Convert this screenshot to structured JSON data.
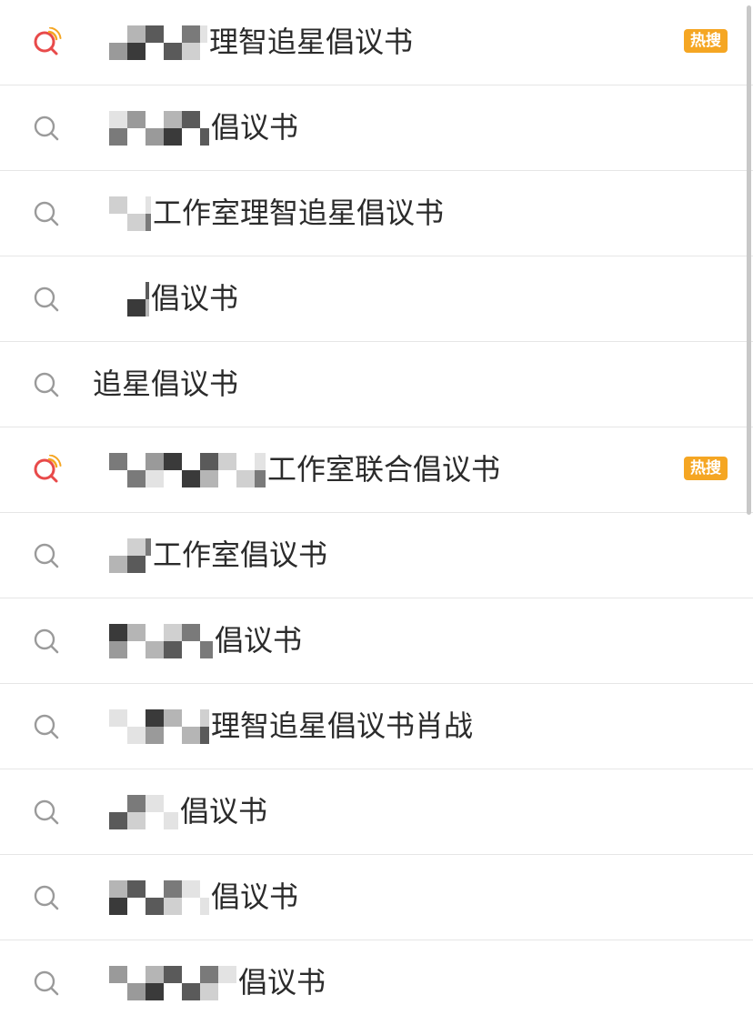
{
  "hot_badge_label": "热搜",
  "colors": {
    "hot_icon_red": "#e84a4a",
    "hot_icon_orange": "#f5a623",
    "badge_bg": "#f5a623",
    "normal_icon": "#9a9a9a",
    "text": "#2b2b2b",
    "divider": "#e6e6e6"
  },
  "results": [
    {
      "text": "理智追星倡议书",
      "hot": true,
      "redacted": true
    },
    {
      "text": "倡议书",
      "hot": false,
      "redacted": true
    },
    {
      "text": "工作室理智追星倡议书",
      "hot": false,
      "redacted": true
    },
    {
      "text": "倡议书",
      "hot": false,
      "redacted": true
    },
    {
      "text": "追星倡议书",
      "hot": false,
      "redacted": false
    },
    {
      "text": "工作室联合倡议书",
      "hot": true,
      "redacted": true
    },
    {
      "text": "工作室倡议书",
      "hot": false,
      "redacted": true
    },
    {
      "text": "倡议书",
      "hot": false,
      "redacted": true
    },
    {
      "text": "理智追星倡议书肖战",
      "hot": false,
      "redacted": true
    },
    {
      "text": "倡议书",
      "hot": false,
      "redacted": true
    },
    {
      "text": "倡议书",
      "hot": false,
      "redacted": true
    },
    {
      "text": "倡议书",
      "hot": false,
      "redacted": true
    }
  ]
}
